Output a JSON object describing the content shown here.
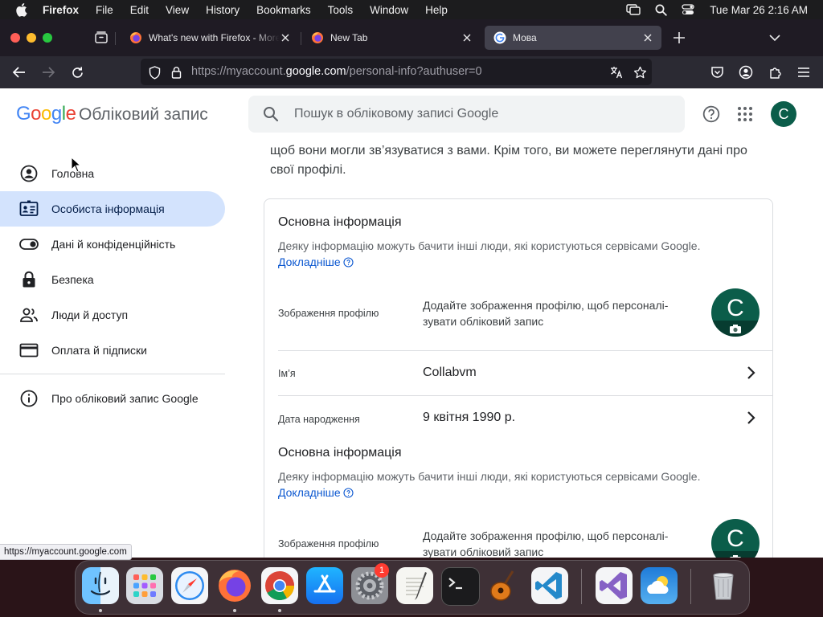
{
  "menubar": {
    "items": [
      "Firefox",
      "File",
      "Edit",
      "View",
      "History",
      "Bookmarks",
      "Tools",
      "Window",
      "Help"
    ],
    "clock": "Tue Mar 26  2:16 AM"
  },
  "tabs": [
    {
      "title": "What's new with Firefox - More"
    },
    {
      "title": "New Tab"
    },
    {
      "title": "Мова"
    }
  ],
  "address_bar": {
    "url_prefix": "https://myaccount.",
    "url_host": "google.com",
    "url_path": "/personal-info?authuser=0"
  },
  "header": {
    "logo": "Google",
    "account_title": "Обліковий запис",
    "search_placeholder": "Пошук в обліковому записі Google",
    "avatar_letter": "C"
  },
  "sidenav": {
    "items": [
      {
        "label": "Головна",
        "icon": "account-circle-icon"
      },
      {
        "label": "Особиста інформація",
        "icon": "id-card-icon",
        "active": true
      },
      {
        "label": "Дані й конфіденційність",
        "icon": "toggle-icon"
      },
      {
        "label": "Безпека",
        "icon": "lock-icon"
      },
      {
        "label": "Люди й доступ",
        "icon": "people-icon"
      },
      {
        "label": "Оплата й підписки",
        "icon": "credit-card-icon"
      }
    ],
    "about": "Про обліковий запис Google"
  },
  "main": {
    "intro": "щоб вони могли зв’язуватися з вами. Крім того, ви можете переглянути дані про свої профілі.",
    "card": {
      "title": "Основна інформація",
      "description": "Деяку інформацію можуть бачити інші люди, які користуються сервісами Google.",
      "learn_more": "Докладніше",
      "photo_label": "Зображення профілю",
      "photo_text": "Додайте зображення профілю, щоб персоналі-зувати обліковий запис",
      "name_label": "Ім’я",
      "name_value": "Collabvm",
      "birthday_label": "Дата народження",
      "birthday_value": "9 квітня 1990 р."
    },
    "card_repeat": {
      "title": "Основна інформація",
      "description": "Деяку інформацію можуть бачити інші люди, які користуються сервісами Google.",
      "learn_more": "Докладніше",
      "photo_label": "Зображення профілю",
      "photo_text": "Додайте зображення профілю, щоб персоналі-зувати обліковий запис"
    }
  },
  "status_link": "https://myaccount.google.com",
  "dock": {
    "apps": [
      "Finder",
      "Launchpad",
      "Safari",
      "Firefox",
      "Google Chrome",
      "App Store",
      "System Settings",
      "TextEdit",
      "Terminal",
      "GarageBand",
      "Visual Studio Code",
      "Visual Studio",
      "Weather",
      "Trash"
    ],
    "settings_badge": "1"
  }
}
